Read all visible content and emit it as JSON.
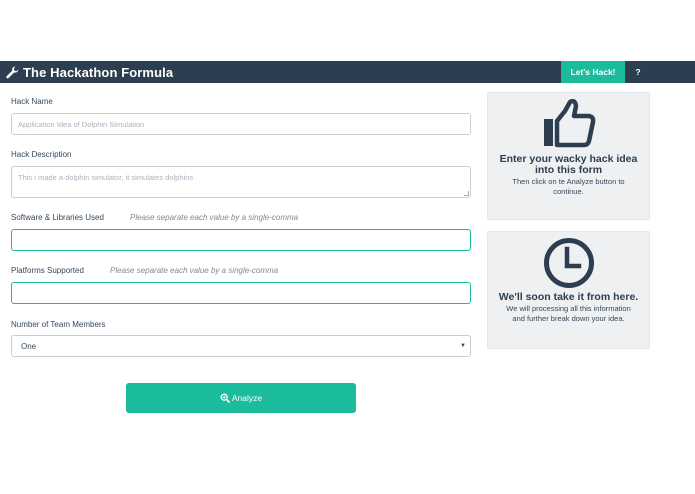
{
  "navbar": {
    "brand_icon": "wrench-icon",
    "brand": "The Hackathon Formula",
    "lets_hack": "Let's Hack!",
    "help": "?"
  },
  "form": {
    "hack_name": {
      "label": "Hack Name",
      "placeholder": "Application Idea of Dolphin Simulation",
      "value": ""
    },
    "hack_description": {
      "label": "Hack Description",
      "placeholder": "This i made a dolphin simulator, it simulates dolphins",
      "value": ""
    },
    "software": {
      "label": "Software & Libraries Used",
      "hint": "Please separate each value by a single-comma",
      "value": ""
    },
    "platforms": {
      "label": "Platforms Supported",
      "hint": "Please separate each value by a single-comma",
      "value": ""
    },
    "team_members": {
      "label": "Number of Team Members",
      "selected": "One"
    },
    "analyze": {
      "label": "Analyze",
      "icon": "search-plus-icon"
    }
  },
  "cards": [
    {
      "icon": "thumbs-up-icon",
      "title_line1": "Enter your wacky hack idea",
      "title_line2": "into this form",
      "text_line1": "Then click on te Analyze button to",
      "text_line2": "continue."
    },
    {
      "icon": "clock-icon",
      "title_line1": "We'll soon take it from here.",
      "text_line1": "We will processing all this information",
      "text_line2": "and further break down your idea."
    }
  ],
  "colors": {
    "navbar": "#2c3e50",
    "accent": "#1abc9c",
    "card_bg": "#eef0f2"
  }
}
